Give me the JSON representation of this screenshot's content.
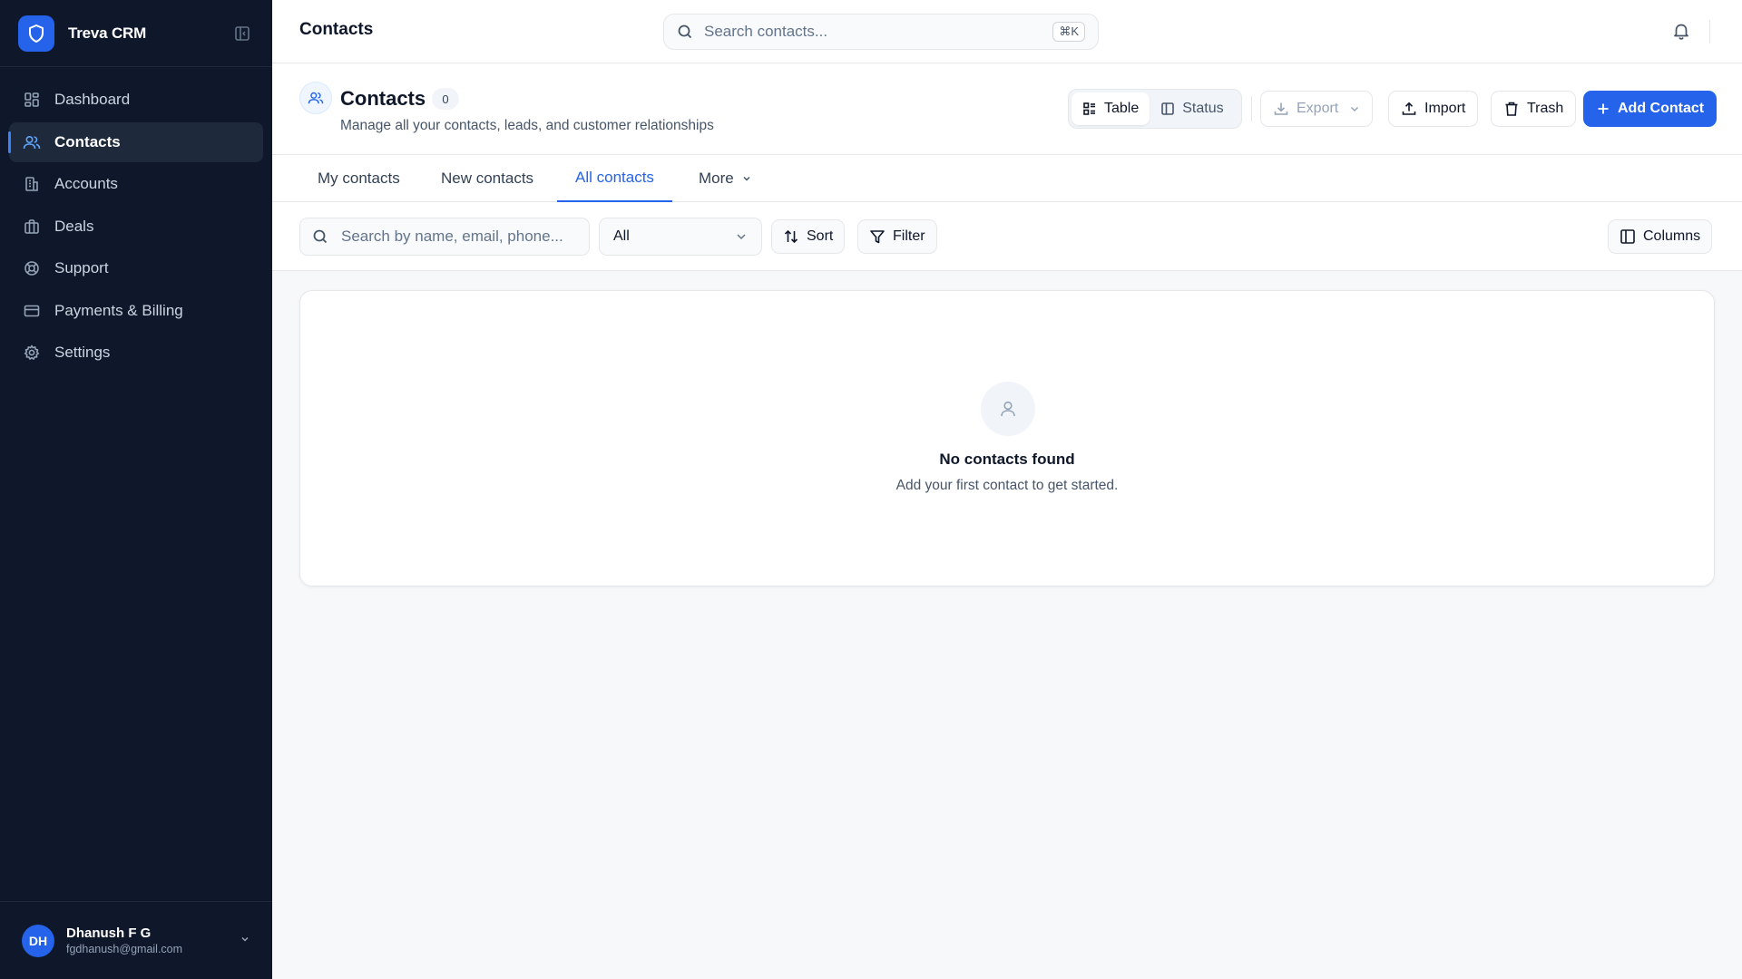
{
  "app": {
    "name": "Treva CRM"
  },
  "sidebar": {
    "items": [
      {
        "label": "Dashboard",
        "icon": "dashboard-icon",
        "active": false
      },
      {
        "label": "Contacts",
        "icon": "users-icon",
        "active": true
      },
      {
        "label": "Accounts",
        "icon": "building-icon",
        "active": false
      },
      {
        "label": "Deals",
        "icon": "briefcase-icon",
        "active": false
      },
      {
        "label": "Support",
        "icon": "lifebuoy-icon",
        "active": false
      },
      {
        "label": "Payments & Billing",
        "icon": "credit-card-icon",
        "active": false
      },
      {
        "label": "Settings",
        "icon": "gear-icon",
        "active": false
      }
    ],
    "user": {
      "initials": "DH",
      "name": "Dhanush F G",
      "email": "fgdhanush@gmail.com"
    }
  },
  "header": {
    "title": "Contacts",
    "search_placeholder": "Search contacts...",
    "shortcut": "⌘K"
  },
  "page": {
    "title": "Contacts",
    "count": "0",
    "subtitle": "Manage all your contacts, leads, and customer relationships",
    "views": [
      {
        "label": "Table",
        "active": true
      },
      {
        "label": "Status",
        "active": false
      }
    ],
    "actions": {
      "export": "Export",
      "import": "Import",
      "trash": "Trash",
      "add": "Add Contact"
    }
  },
  "tabs": [
    {
      "label": "My contacts",
      "active": false
    },
    {
      "label": "New contacts",
      "active": false
    },
    {
      "label": "All contacts",
      "active": true
    },
    {
      "label": "More",
      "active": false
    }
  ],
  "toolbar": {
    "search_placeholder": "Search by name, email, phone...",
    "filter_select": "All",
    "sort": "Sort",
    "filter": "Filter",
    "columns": "Columns"
  },
  "empty_state": {
    "title": "No contacts found",
    "subtitle": "Add your first contact to get started."
  },
  "colors": {
    "sidebar_bg": "#0f172a",
    "accent": "#2563eb",
    "page_bg": "#f7f8fa"
  }
}
